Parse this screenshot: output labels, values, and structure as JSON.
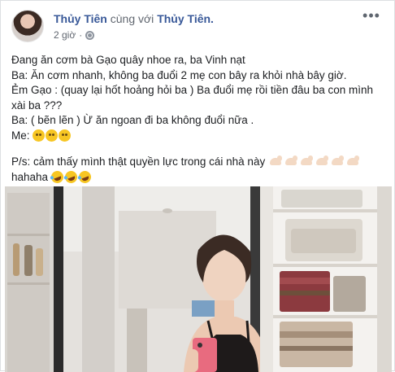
{
  "post": {
    "author": "Thủy Tiên",
    "with_text": " cùng với ",
    "tagged": "Thủy Tiên.",
    "time": "2 giờ",
    "dot": "·",
    "more_icon": "more-horizontal-icon",
    "privacy_icon": "globe-icon",
    "lines": [
      "Đang ăn cơm bà Gạo quây nhoe ra, ba Vinh nạt",
      "Ba: Ăn cơm nhanh, không ba đuổi 2 mẹ con bây ra khỏi nhà bây giờ.",
      "Ẻm Gạo : (quay lại hốt hoảng hỏi ba ) Ba đuổi mẹ rồi tiền đâu ba con mình xài ba ???",
      "Ba: ( bẽn lẽn ) Ừ ăn ngoan đi ba không đuổi nữa .",
      "Me:"
    ],
    "ps_text": "P/s: cảm thấy mình thật quyền lực trong cái nhà này",
    "ps_suffix": "hahaha",
    "emoji": {
      "me_line": "pleading-face-icon",
      "ps_line": "flexed-biceps-icon",
      "laugh": "rolling-laughing-icon"
    },
    "photo": "mirror-selfie-photo"
  }
}
